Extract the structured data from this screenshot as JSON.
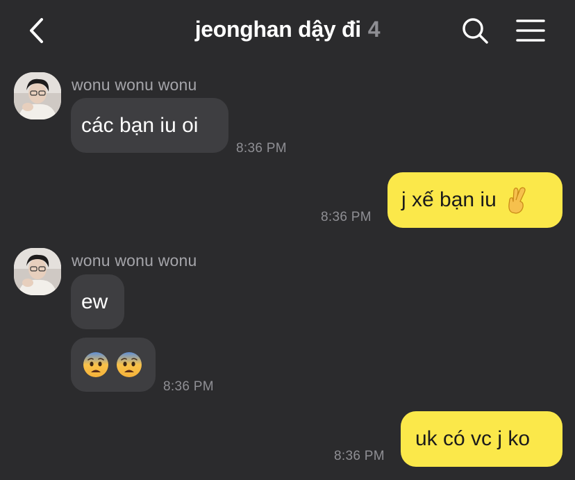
{
  "header": {
    "title": "jeonghan dậy đi",
    "member_count": "4",
    "icons": {
      "back": "chevron-left-icon",
      "search": "search-icon",
      "menu": "hamburger-menu-icon"
    }
  },
  "messages": [
    {
      "direction": "incoming",
      "sender": "wonu wonu wonu",
      "text": "các bạn iu oi",
      "time": "8:36 PM"
    },
    {
      "direction": "outgoing",
      "text": "j xế bạn iu",
      "emoji": "crossed-fingers-emoji",
      "time": "8:36 PM"
    },
    {
      "direction": "incoming",
      "sender": "wonu wonu wonu",
      "text": "ew",
      "time": ""
    },
    {
      "direction": "incoming",
      "emoji": "anxious-face-emoji x2",
      "time": "8:36 PM"
    },
    {
      "direction": "outgoing",
      "text": "uk có vc j ko",
      "time": "8:36 PM"
    }
  ],
  "colors": {
    "background": "#2b2b2d",
    "incoming_bubble": "#3e3e41",
    "outgoing_bubble": "#fbe84a",
    "timestamp": "#8f8f94",
    "sender_name": "#a5a5aa"
  }
}
